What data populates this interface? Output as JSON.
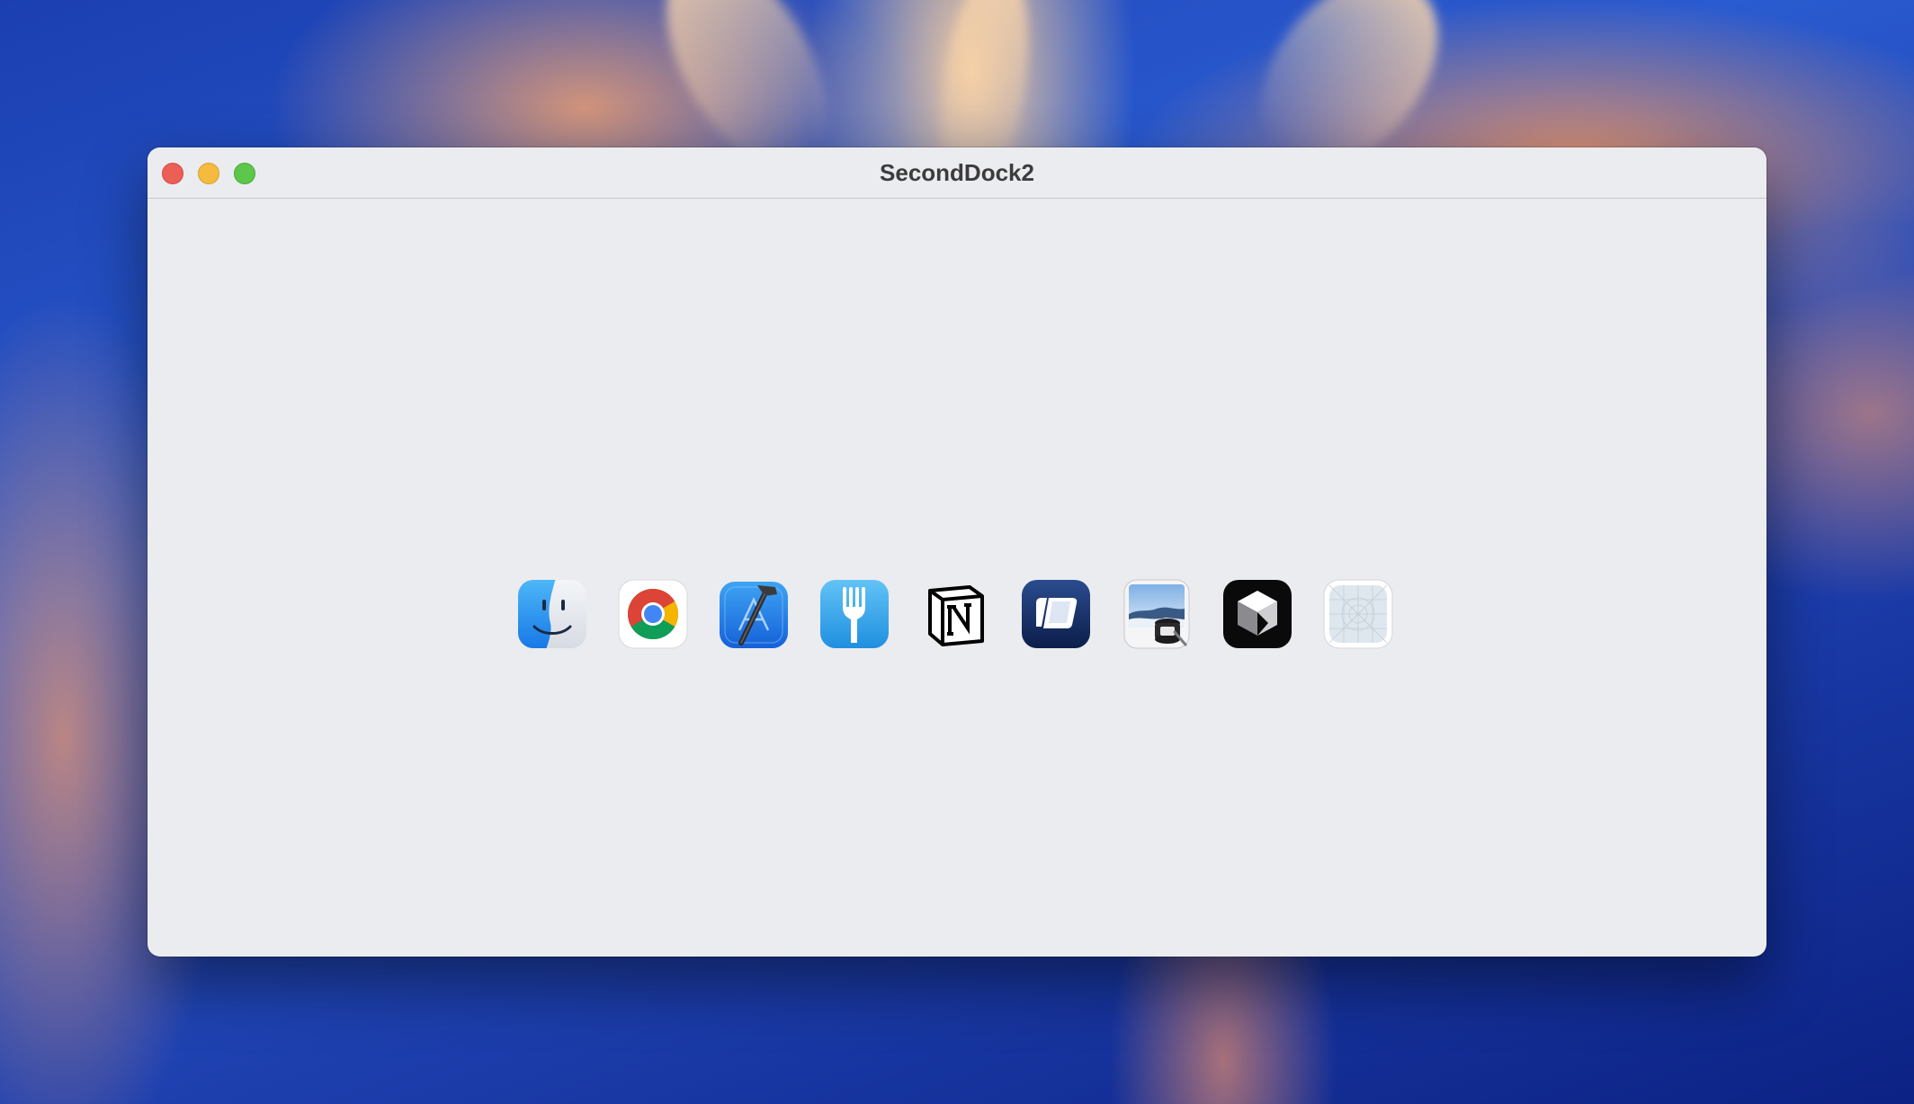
{
  "window": {
    "title": "SecondDock2"
  },
  "dock": {
    "apps": [
      {
        "icon": "finder-icon"
      },
      {
        "icon": "chrome-icon"
      },
      {
        "icon": "xcode-icon"
      },
      {
        "icon": "fork-icon"
      },
      {
        "icon": "notion-icon"
      },
      {
        "icon": "crossover-icon"
      },
      {
        "icon": "preview-icon"
      },
      {
        "icon": "cube-app-icon"
      },
      {
        "icon": "generic-app-icon"
      }
    ]
  },
  "colors": {
    "close": "#ec5f57",
    "minimize": "#f4bb3f",
    "maximize": "#5dc74b",
    "window_bg": "#ebecef"
  }
}
